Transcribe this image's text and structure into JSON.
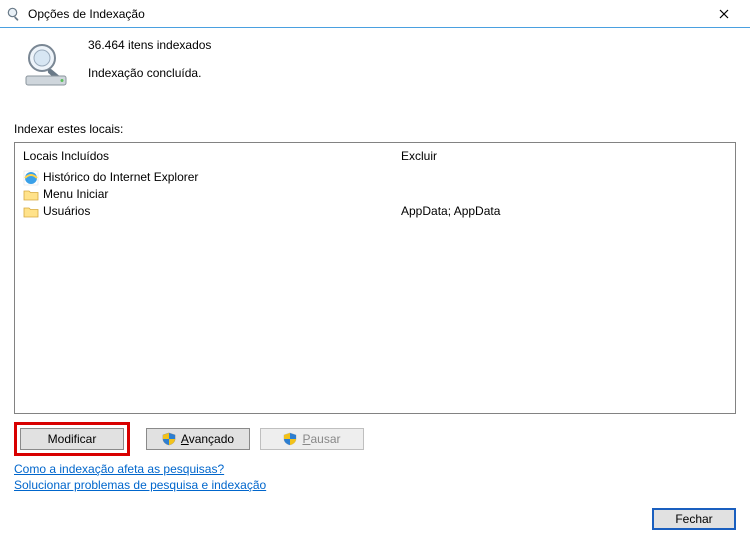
{
  "window": {
    "title": "Opções de Indexação"
  },
  "status": {
    "count_line": "36.464 itens indexados",
    "state_line": "Indexação concluída."
  },
  "section_label": "Indexar estes locais:",
  "columns": {
    "included_header": "Locais Incluídos",
    "excluded_header": "Excluir"
  },
  "locations": [
    {
      "icon": "ie-icon",
      "label": "Histórico do Internet Explorer",
      "exclude": ""
    },
    {
      "icon": "folder-icon",
      "label": "Menu Iniciar",
      "exclude": ""
    },
    {
      "icon": "folder-icon",
      "label": "Usuários",
      "exclude": "AppData; AppData"
    }
  ],
  "buttons": {
    "modify": "Modificar",
    "advanced": "vançado",
    "advanced_mnemonic": "A",
    "pause": "ausar",
    "pause_mnemonic": "P"
  },
  "links": {
    "how_affects": "Como a indexação afeta as pesquisas?",
    "troubleshoot": "Solucionar problemas de pesquisa e indexação"
  },
  "footer": {
    "close": "Fechar"
  }
}
